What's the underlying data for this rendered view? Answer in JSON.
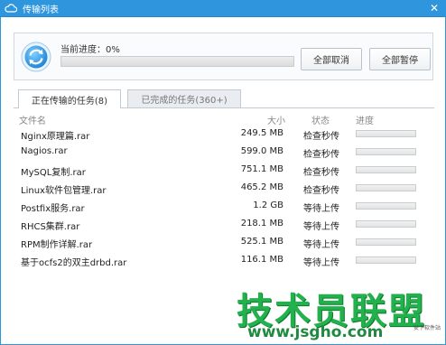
{
  "window": {
    "title": "传输列表",
    "close_glyph": "✕"
  },
  "progress": {
    "label": "当前进度：0%",
    "value_percent": 0
  },
  "buttons": {
    "cancel_all": "全部取消",
    "pause_all": "全部暂停"
  },
  "tabs": [
    {
      "label": "正在传输的任务(8)",
      "active": true
    },
    {
      "label": "已完成的任务(360+)",
      "active": false
    }
  ],
  "columns": {
    "name": "文件名",
    "size": "大小",
    "status": "状态",
    "progress": "进度"
  },
  "rows": [
    {
      "name": "Nginx原理篇.rar",
      "size": "249.5 MB",
      "status": "检查秒传",
      "progress": 0
    },
    {
      "name": "Nagios.rar",
      "size": "599.0 MB",
      "status": "检查秒传",
      "progress": 0
    },
    {
      "name": "MySQL复制.rar",
      "size": "751.1 MB",
      "status": "检查秒传",
      "progress": 0
    },
    {
      "name": "Linux软件包管理.rar",
      "size": "465.2 MB",
      "status": "检查秒传",
      "progress": 0
    },
    {
      "name": "Postfix服务.rar",
      "size": "1.2 GB",
      "status": "等待上传",
      "progress": 0
    },
    {
      "name": "RHCS集群.rar",
      "size": "218.1 MB",
      "status": "等待上传",
      "progress": 0
    },
    {
      "name": "RPM制作详解.rar",
      "size": "525.1 MB",
      "status": "等待上传",
      "progress": 0
    },
    {
      "name": "基于ocfs2的双主drbd.rar",
      "size": "116.1 MB",
      "status": "等待上传",
      "progress": 0
    }
  ],
  "watermark": {
    "main": "技术员联盟",
    "url": "www.jsgho.com",
    "tag": "安下软件站"
  },
  "icons": {
    "title": "cloud-icon",
    "sync": "sync-icon",
    "close": "close-icon"
  },
  "colors": {
    "titlebar": "#2f96de",
    "accent": "#3a9be0",
    "watermark": "#22b14c"
  }
}
